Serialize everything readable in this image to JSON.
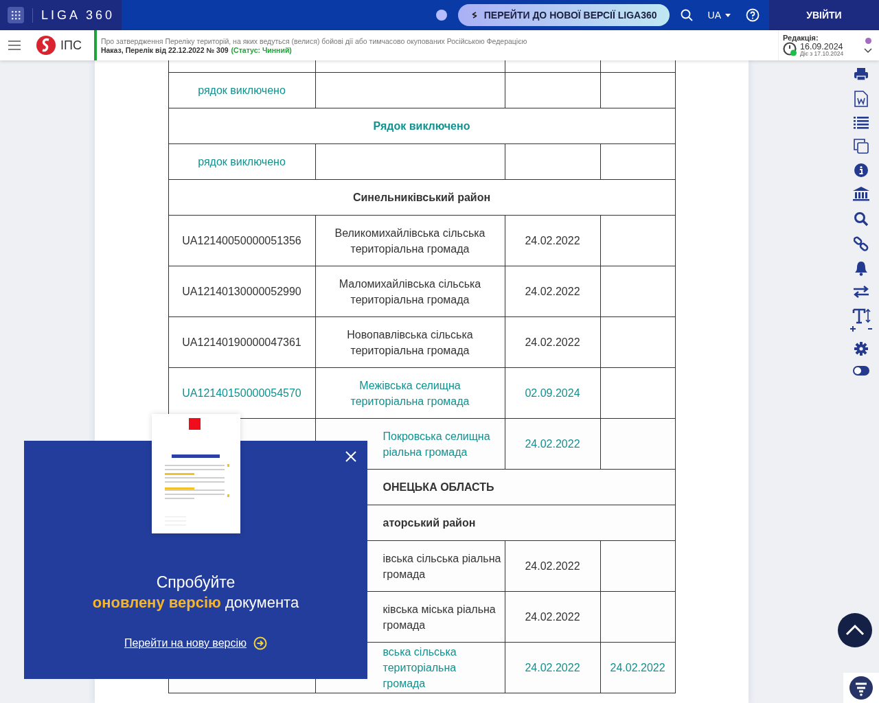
{
  "topbar": {
    "logo": "LIGA 360",
    "new_version_button": "ПЕРЕЙТИ ДО НОВОЇ ВЕРСІЇ LIGA360",
    "language": "UA",
    "login_button": "УВІЙТИ"
  },
  "docbar": {
    "brand": "ІПС",
    "title": "Про затвердження Переліку територій, на яких ведуться (велися) бойові дії або тимчасово окупованих Російською Федерацією",
    "subtitle": "Наказ, Перелік від 22.12.2022 № 309",
    "status": "(Статус: Чинний)",
    "edition_label": "Редакція:",
    "edition_date": "16.09.2024",
    "edition_effective": "Діє з 17.10.2024"
  },
  "table": {
    "rows": [
      {
        "kind": "data",
        "cells": [
          "",
          "",
          "",
          ""
        ]
      },
      {
        "kind": "data",
        "changed": true,
        "covered": false,
        "cells": [
          "рядок виключено",
          "",
          "",
          ""
        ]
      },
      {
        "kind": "section",
        "changed": true,
        "covered": false,
        "text": "Рядок виключено"
      },
      {
        "kind": "data",
        "changed": true,
        "covered": false,
        "cells": [
          "рядок виключено",
          "",
          "",
          ""
        ]
      },
      {
        "kind": "section",
        "changed": false,
        "covered": false,
        "text": "Синельниківський район"
      },
      {
        "kind": "data",
        "changed": false,
        "covered": false,
        "cells": [
          "UA12140050000051356",
          "Великомихайлівська сільська територіальна громада",
          "24.02.2022",
          ""
        ]
      },
      {
        "kind": "data",
        "changed": false,
        "covered": false,
        "cells": [
          "UA12140130000052990",
          "Маломихайлівська сільська територіальна громада",
          "24.02.2022",
          ""
        ]
      },
      {
        "kind": "data",
        "changed": false,
        "covered": false,
        "cells": [
          "UA12140190000047361",
          "Новопавлівська сільська територіальна громада",
          "24.02.2022",
          ""
        ]
      },
      {
        "kind": "data",
        "changed": true,
        "covered": false,
        "cells": [
          "UA12140150000054570",
          "Межівська селищна територіальна громада",
          "02.09.2024",
          ""
        ]
      },
      {
        "kind": "data",
        "changed": true,
        "covered": true,
        "cells": [
          "",
          "Покровська селищна ріальна громада",
          "24.02.2022",
          ""
        ]
      },
      {
        "kind": "section",
        "changed": false,
        "covered": true,
        "text": "ОНЕЦЬКА ОБЛАСТЬ"
      },
      {
        "kind": "section",
        "changed": false,
        "covered": true,
        "text": "аторський район"
      },
      {
        "kind": "data",
        "changed": false,
        "covered": true,
        "cells": [
          "",
          "івська сільська ріальна громада",
          "24.02.2022",
          ""
        ]
      },
      {
        "kind": "data",
        "changed": false,
        "covered": true,
        "cells": [
          "",
          "ківська міська ріальна громада",
          "24.02.2022",
          ""
        ]
      },
      {
        "kind": "data",
        "changed": true,
        "covered": true,
        "cells": [
          "",
          "вська сільська територіальна громада",
          "24.02.2022",
          "24.02.2022"
        ]
      }
    ]
  },
  "popup": {
    "line1": "Спробуйте",
    "line2": "**оновлену версію** документа",
    "link": "Перейти на нову версію"
  }
}
